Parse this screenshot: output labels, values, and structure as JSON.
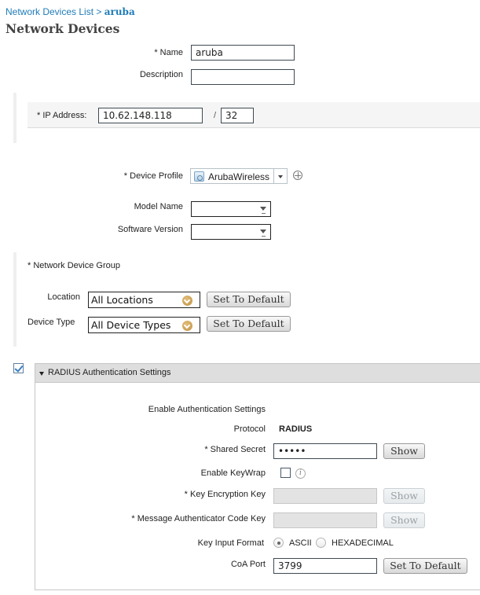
{
  "breadcrumb": {
    "parent": "Network Devices List",
    "separator": ">",
    "current": "aruba"
  },
  "page_title": "Network Devices",
  "general": {
    "name_label": "* Name",
    "name_value": "aruba",
    "description_label": "Description",
    "description_value": ""
  },
  "ip": {
    "label": "* IP Address:",
    "address": "10.62.148.118",
    "slash": "/",
    "mask": "32"
  },
  "profile": {
    "device_profile_label": "* Device Profile",
    "device_profile_value": "ArubaWireless",
    "model_name_label": "Model Name",
    "model_name_value": "",
    "software_version_label": "Software Version",
    "software_version_value": ""
  },
  "ndg": {
    "title": "* Network Device Group",
    "location_label": "Location",
    "location_value": "All Locations",
    "device_type_label": "Device Type",
    "device_type_value": "All Device Types",
    "set_default_label": "Set To Default"
  },
  "radius": {
    "enabled": true,
    "title": "RADIUS Authentication Settings",
    "enable_auth_label": "Enable Authentication Settings",
    "protocol_label": "Protocol",
    "protocol_value": "RADIUS",
    "shared_secret_label": "* Shared Secret",
    "shared_secret_value": "•••••",
    "show_label": "Show",
    "keywrap_label": "Enable KeyWrap",
    "keywrap_checked": false,
    "kek_label": "* Key Encryption Key",
    "kek_value": "",
    "mack_label": "* Message Authenticator Code Key",
    "mack_value": "",
    "key_input_format_label": "Key Input Format",
    "format_options": [
      "ASCII",
      "HEXADECIMAL"
    ],
    "format_selected": "ASCII",
    "coa_port_label": "CoA Port",
    "coa_port_value": "3799",
    "set_default_label": "Set To Default"
  },
  "colors": {
    "link": "#1e7bb8",
    "title": "#444444",
    "panel_header": "#dedede",
    "knob": "#c9a05a"
  }
}
